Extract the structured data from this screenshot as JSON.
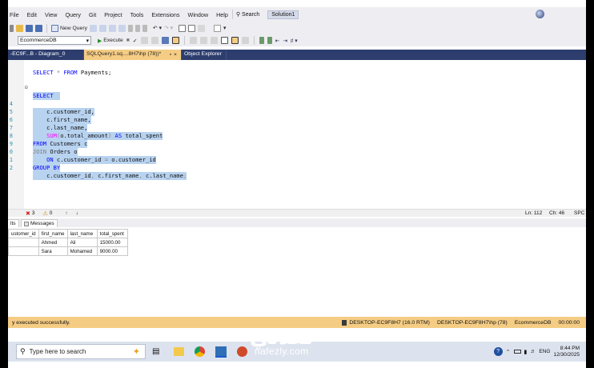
{
  "menu": {
    "items": [
      "File",
      "Edit",
      "View",
      "Query",
      "Git",
      "Project",
      "Tools",
      "Extensions",
      "Window",
      "Help"
    ],
    "search_label": "Search",
    "solution_label": "Solution1"
  },
  "toolbar": {
    "new_query_label": "New Query",
    "database": "EcommerceDB",
    "execute_label": "Execute"
  },
  "tabs": [
    {
      "label": "-EC9F...B - Diagram_0",
      "active": false
    },
    {
      "label": "SQLQuery1.sq....8H7\\hp (78))*",
      "active": true
    },
    {
      "label": "Object Explorer",
      "active": false
    }
  ],
  "editor": {
    "lines": [
      {
        "num": "",
        "text": "SELECT * FROM Payments;"
      },
      {
        "num": "",
        "text": ""
      },
      {
        "num": "",
        "text": ""
      },
      {
        "num": "",
        "text": "SELECT"
      },
      {
        "num": "4",
        "text": "    c.customer_id,"
      },
      {
        "num": "5",
        "text": "    c.first_name,"
      },
      {
        "num": "6",
        "text": "    c.last_name,"
      },
      {
        "num": "7",
        "text": "    SUM(o.total_amount) AS total_spent"
      },
      {
        "num": "8",
        "text": "FROM Customers c"
      },
      {
        "num": "9",
        "text": "JOIN Orders o"
      },
      {
        "num": "0",
        "text": "    ON c.customer_id = o.customer_id"
      },
      {
        "num": "1",
        "text": "GROUP BY"
      },
      {
        "num": "2",
        "text": "    c.customer_id, c.first_name, c.last_name;"
      }
    ]
  },
  "editor_status": {
    "errors": "3",
    "warnings": "0",
    "line": "Ln: 112",
    "col": "Ch: 46",
    "mode": "SPC"
  },
  "results": {
    "tabs": [
      "lts",
      "Messages"
    ],
    "columns": [
      "ustomer_id",
      "first_name",
      "last_name",
      "total_spent"
    ],
    "rows": [
      [
        "",
        "Ahmed",
        "Ali",
        "15000.00"
      ],
      [
        "",
        "Sara",
        "Mohamed",
        "9000.00"
      ]
    ]
  },
  "status": {
    "message": "y executed successfully.",
    "server": "DESKTOP-EC9F8H7 (16.0 RTM)",
    "user": "DESKTOP-EC9F8H7\\hp (78)",
    "db": "EcommerceDB",
    "elapsed": "00:00:00"
  },
  "taskbar": {
    "search_placeholder": "Type here to search",
    "lang": "ENG",
    "time": "8:44 PM",
    "date": "12/30/2025"
  },
  "watermark": {
    "arabic": "نفذلي",
    "latin": "nafezly.com"
  }
}
